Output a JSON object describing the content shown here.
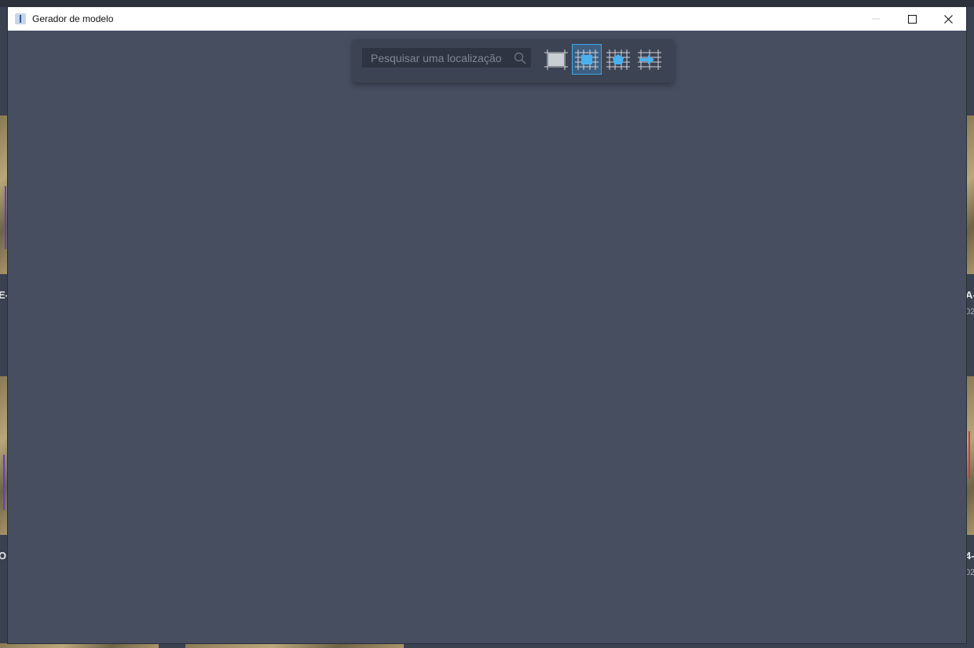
{
  "window": {
    "title": "Gerador de modelo"
  },
  "window_controls": {
    "minimize": "minimize-icon",
    "maximize": "maximize-icon",
    "close": "close-icon"
  },
  "toolbar": {
    "search": {
      "placeholder": "Pesquisar uma localização",
      "icon": "search-icon"
    },
    "tools": [
      {
        "icon": "full-extent-icon",
        "active": false
      },
      {
        "icon": "rectangle-select-icon",
        "active": true
      },
      {
        "icon": "polygon-select-icon",
        "active": false
      },
      {
        "icon": "import-boundary-icon",
        "active": false
      }
    ]
  },
  "background_labels": {
    "left_top": "E-",
    "left_bottom": "O",
    "right_top": "A-",
    "right_top_sub": "02",
    "right_bottom": "4-",
    "right_bottom_sub": "02"
  },
  "colors": {
    "canvas": "#464e60",
    "toolbar": "#3c4352",
    "accent": "#3ea6e6"
  }
}
